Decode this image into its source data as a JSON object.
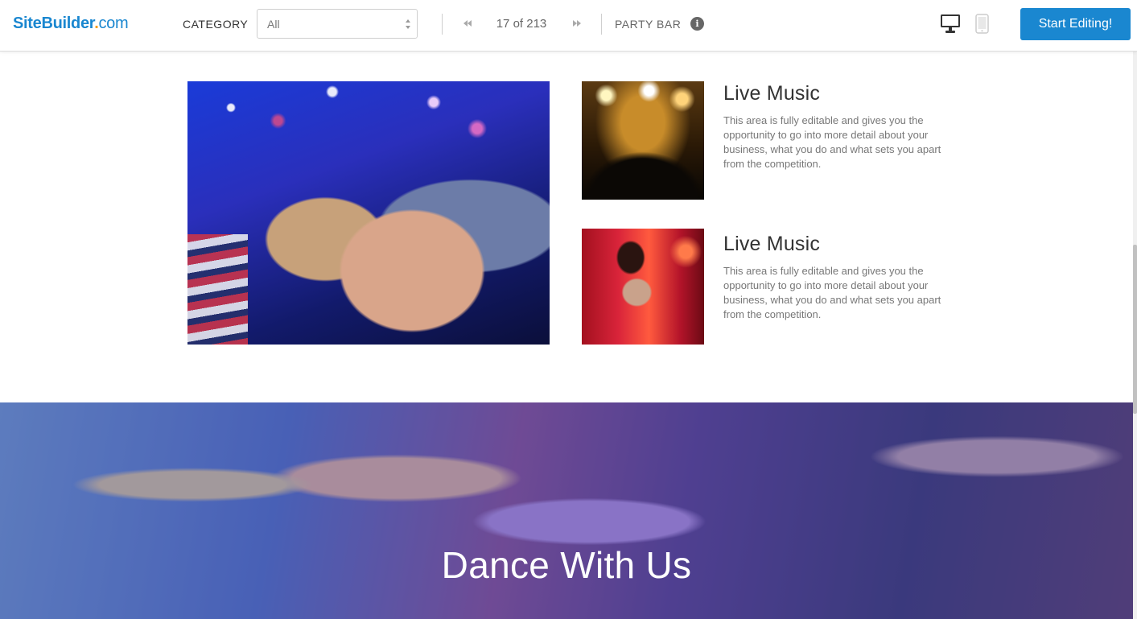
{
  "toolbar": {
    "logo": {
      "brand": "SiteBuilder",
      "dot": ".",
      "tld": "com"
    },
    "category_label": "CATEGORY",
    "category_select": {
      "value": "All"
    },
    "pager": {
      "text": "17 of 213"
    },
    "template_name": "PARTY BAR",
    "info_icon_glyph": "i",
    "start_button": "Start Editing!",
    "icons": [
      "select-arrows-icon",
      "previous-icon",
      "next-icon",
      "info-icon",
      "desktop-icon",
      "mobile-icon"
    ]
  },
  "features": [
    {
      "title": "Live Music",
      "text": "This area is fully editable and gives you the opportunity to go into more detail about your business, what you do and what sets you apart from the competition."
    },
    {
      "title": "Live Music",
      "text": "This area is fully editable and gives you the opportunity to go into more detail about your business, what you do and what sets you apart from the competition."
    }
  ],
  "hero": {
    "title": "Dance With Us"
  },
  "colors": {
    "accent": "#1a87d0",
    "logo_dot": "#f39c12",
    "text": "#333333",
    "muted": "#777777"
  }
}
